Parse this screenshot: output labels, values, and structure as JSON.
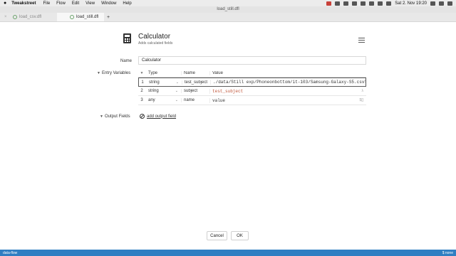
{
  "menubar": {
    "apple": "",
    "app_name": "Tweakstreet",
    "items": [
      "File",
      "Flow",
      "Edit",
      "View",
      "Window",
      "Help"
    ],
    "clock": "Sat 2. Nov  19:20"
  },
  "window": {
    "title": "load_still.dfl"
  },
  "tabs": [
    {
      "label": "load_csv.dfl",
      "active": false
    },
    {
      "label": "load_still.dfl",
      "active": true
    }
  ],
  "tab_add": "+",
  "header": {
    "title": "Calculator",
    "subtitle": "Adds calculated fields"
  },
  "name": {
    "label": "Name",
    "value": "Calculator"
  },
  "entry_variables": {
    "label": "Entry Variables",
    "columns": [
      "Type",
      "Name",
      "Value"
    ],
    "rows": [
      {
        "num": "1",
        "type": "string",
        "name": "test_subject",
        "value": "./data/Still exp/Phoneonbottom/it-103/Samsung-Galaxy-S5.csv",
        "selected": true
      },
      {
        "num": "2",
        "type": "string",
        "name": "subject",
        "value": "test_subject",
        "value_style": "orange"
      },
      {
        "num": "3",
        "type": "any",
        "name": "name",
        "value": "value"
      }
    ]
  },
  "output_fields": {
    "label": "Output Fields",
    "add_label": "add output field"
  },
  "buttons": {
    "cancel": "Cancel",
    "ok": "OK"
  },
  "statusbar": {
    "left": "data-flow",
    "right": "$ none"
  },
  "colors": {
    "statusbar": "#2f7ec2",
    "accent_orange": "#c0563a"
  }
}
